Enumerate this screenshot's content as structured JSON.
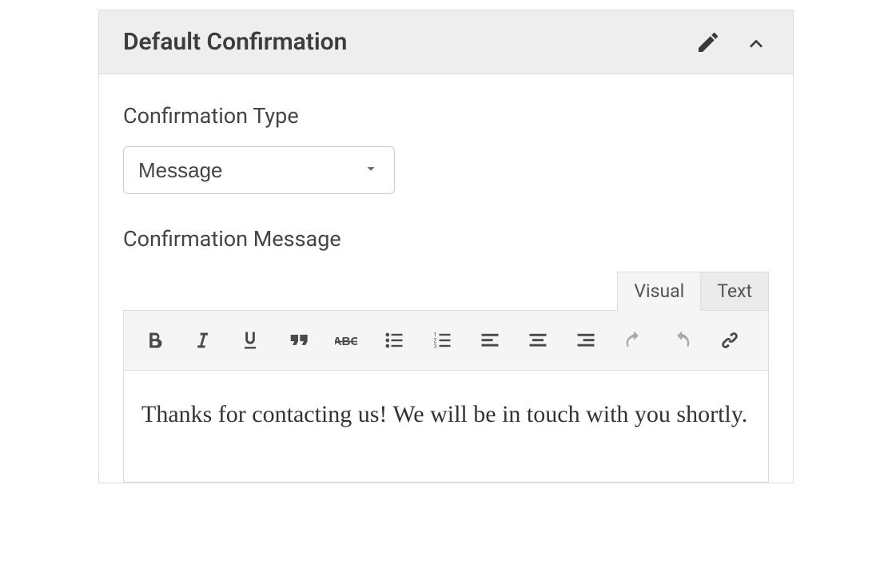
{
  "panel": {
    "title": "Default Confirmation"
  },
  "form": {
    "type_label": "Confirmation Type",
    "type_value": "Message",
    "message_label": "Confirmation Message"
  },
  "editor": {
    "tabs": {
      "visual": "Visual",
      "text": "Text"
    },
    "content": "Thanks for contacting us! We will be in touch with you shortly."
  }
}
